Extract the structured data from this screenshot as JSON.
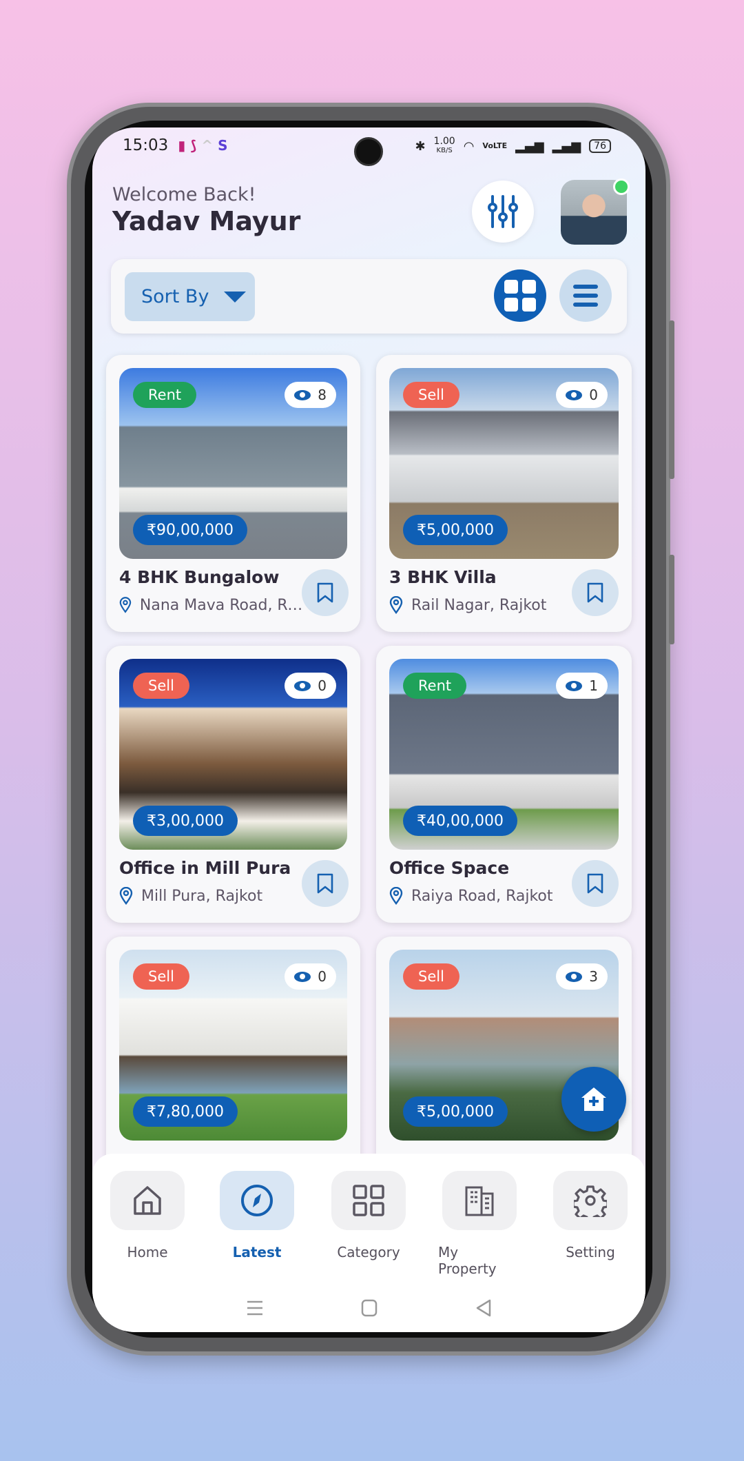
{
  "status_bar": {
    "time": "15:03",
    "network_speed": "1.00",
    "network_unit": "KB/S",
    "volte": "VoLTE",
    "battery": "76"
  },
  "header": {
    "greeting": "Welcome Back!",
    "user_name": "Yadav Mayur",
    "filter_icon": "sliders-icon",
    "online": true
  },
  "toolbar": {
    "sort_label": "Sort By",
    "view_mode": "grid"
  },
  "colors": {
    "primary": "#0f5fb5",
    "rent": "#1fa25a",
    "sell": "#ef6353",
    "online": "#3fd364"
  },
  "listings": [
    {
      "type": "Rent",
      "views": "8",
      "price": "₹90,00,000",
      "title": "4 BHK Bungalow",
      "location": "Nana Mava Road, Rajkot"
    },
    {
      "type": "Sell",
      "views": "0",
      "price": "₹5,00,000",
      "title": "3 BHK Villa",
      "location": "Rail Nagar, Rajkot"
    },
    {
      "type": "Sell",
      "views": "0",
      "price": "₹3,00,000",
      "title": "Office  in Mill Pura",
      "location": "Mill Pura, Rajkot"
    },
    {
      "type": "Rent",
      "views": "1",
      "price": "₹40,00,000",
      "title": "Office Space",
      "location": "Raiya Road, Rajkot"
    },
    {
      "type": "Sell",
      "views": "0",
      "price": "₹7,80,000",
      "title": "",
      "location": ""
    },
    {
      "type": "Sell",
      "views": "3",
      "price": "₹5,00,000",
      "title": "",
      "location": ""
    }
  ],
  "fab": {
    "icon": "add-home-icon"
  },
  "bottom_nav": {
    "active": "Latest",
    "items": [
      {
        "label": "Home",
        "icon": "home-icon"
      },
      {
        "label": "Latest",
        "icon": "compass-icon"
      },
      {
        "label": "Category",
        "icon": "grid-icon"
      },
      {
        "label": "My Property",
        "icon": "building-icon"
      },
      {
        "label": "Setting",
        "icon": "gear-icon"
      }
    ]
  }
}
